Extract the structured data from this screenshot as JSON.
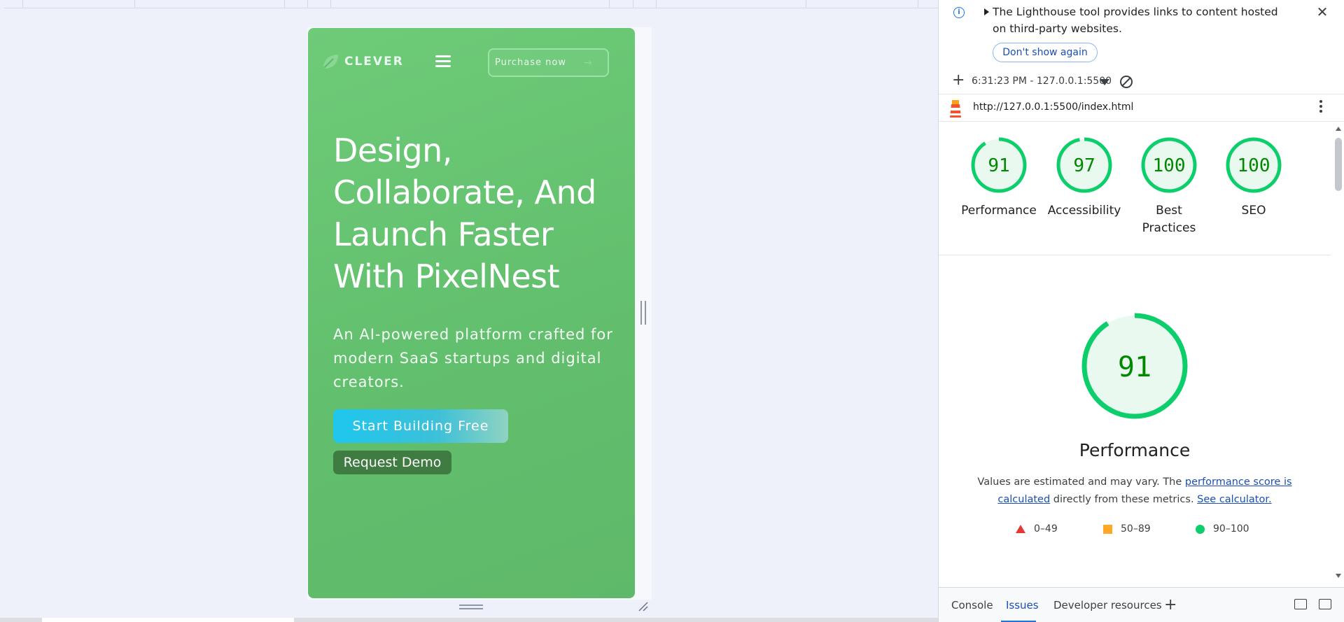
{
  "site": {
    "logo_text": "CLEVER",
    "purchase_label": "Purchase now",
    "hero_title": "Design, Collaborate, And Launch Faster With PixelNest",
    "hero_subtitle": "An AI-powered platform crafted for modern SaaS startups and digital creators.",
    "primary_cta": "Start Building Free",
    "secondary_cta": "Request Demo",
    "colors": {
      "hero_green": "#66c471",
      "cta_cyan": "#1ec6ee",
      "demo_green": "#3e7c41"
    }
  },
  "devtools": {
    "info_banner": {
      "text": "The Lighthouse tool provides links to content hosted on third-party websites.",
      "dismiss_label": "Don't show again"
    },
    "report_selector": "6:31:23 PM - 127.0.0.1:5500",
    "url": "http://127.0.0.1:5500/index.html",
    "scores": [
      {
        "label": "Performance",
        "score": 91
      },
      {
        "label": "Accessibility",
        "score": 97
      },
      {
        "label": "Best Practices",
        "score": 100
      },
      {
        "label": "SEO",
        "score": 100
      }
    ],
    "performance": {
      "score": 91,
      "title": "Performance",
      "desc_prefix": "Values are estimated and may vary. The ",
      "desc_link1": "performance score is calculated",
      "desc_middle": " directly from these metrics. ",
      "desc_link2": "See calculator."
    },
    "legend": {
      "fail": "0–49",
      "average": "50–89",
      "pass": "90–100"
    },
    "tabs": {
      "console": "Console",
      "issues": "Issues",
      "dev_resources": "Developer resources"
    },
    "colors": {
      "pass_green": "#0cce6b",
      "score_text": "#008800",
      "link_blue": "#1a4fb5"
    }
  }
}
